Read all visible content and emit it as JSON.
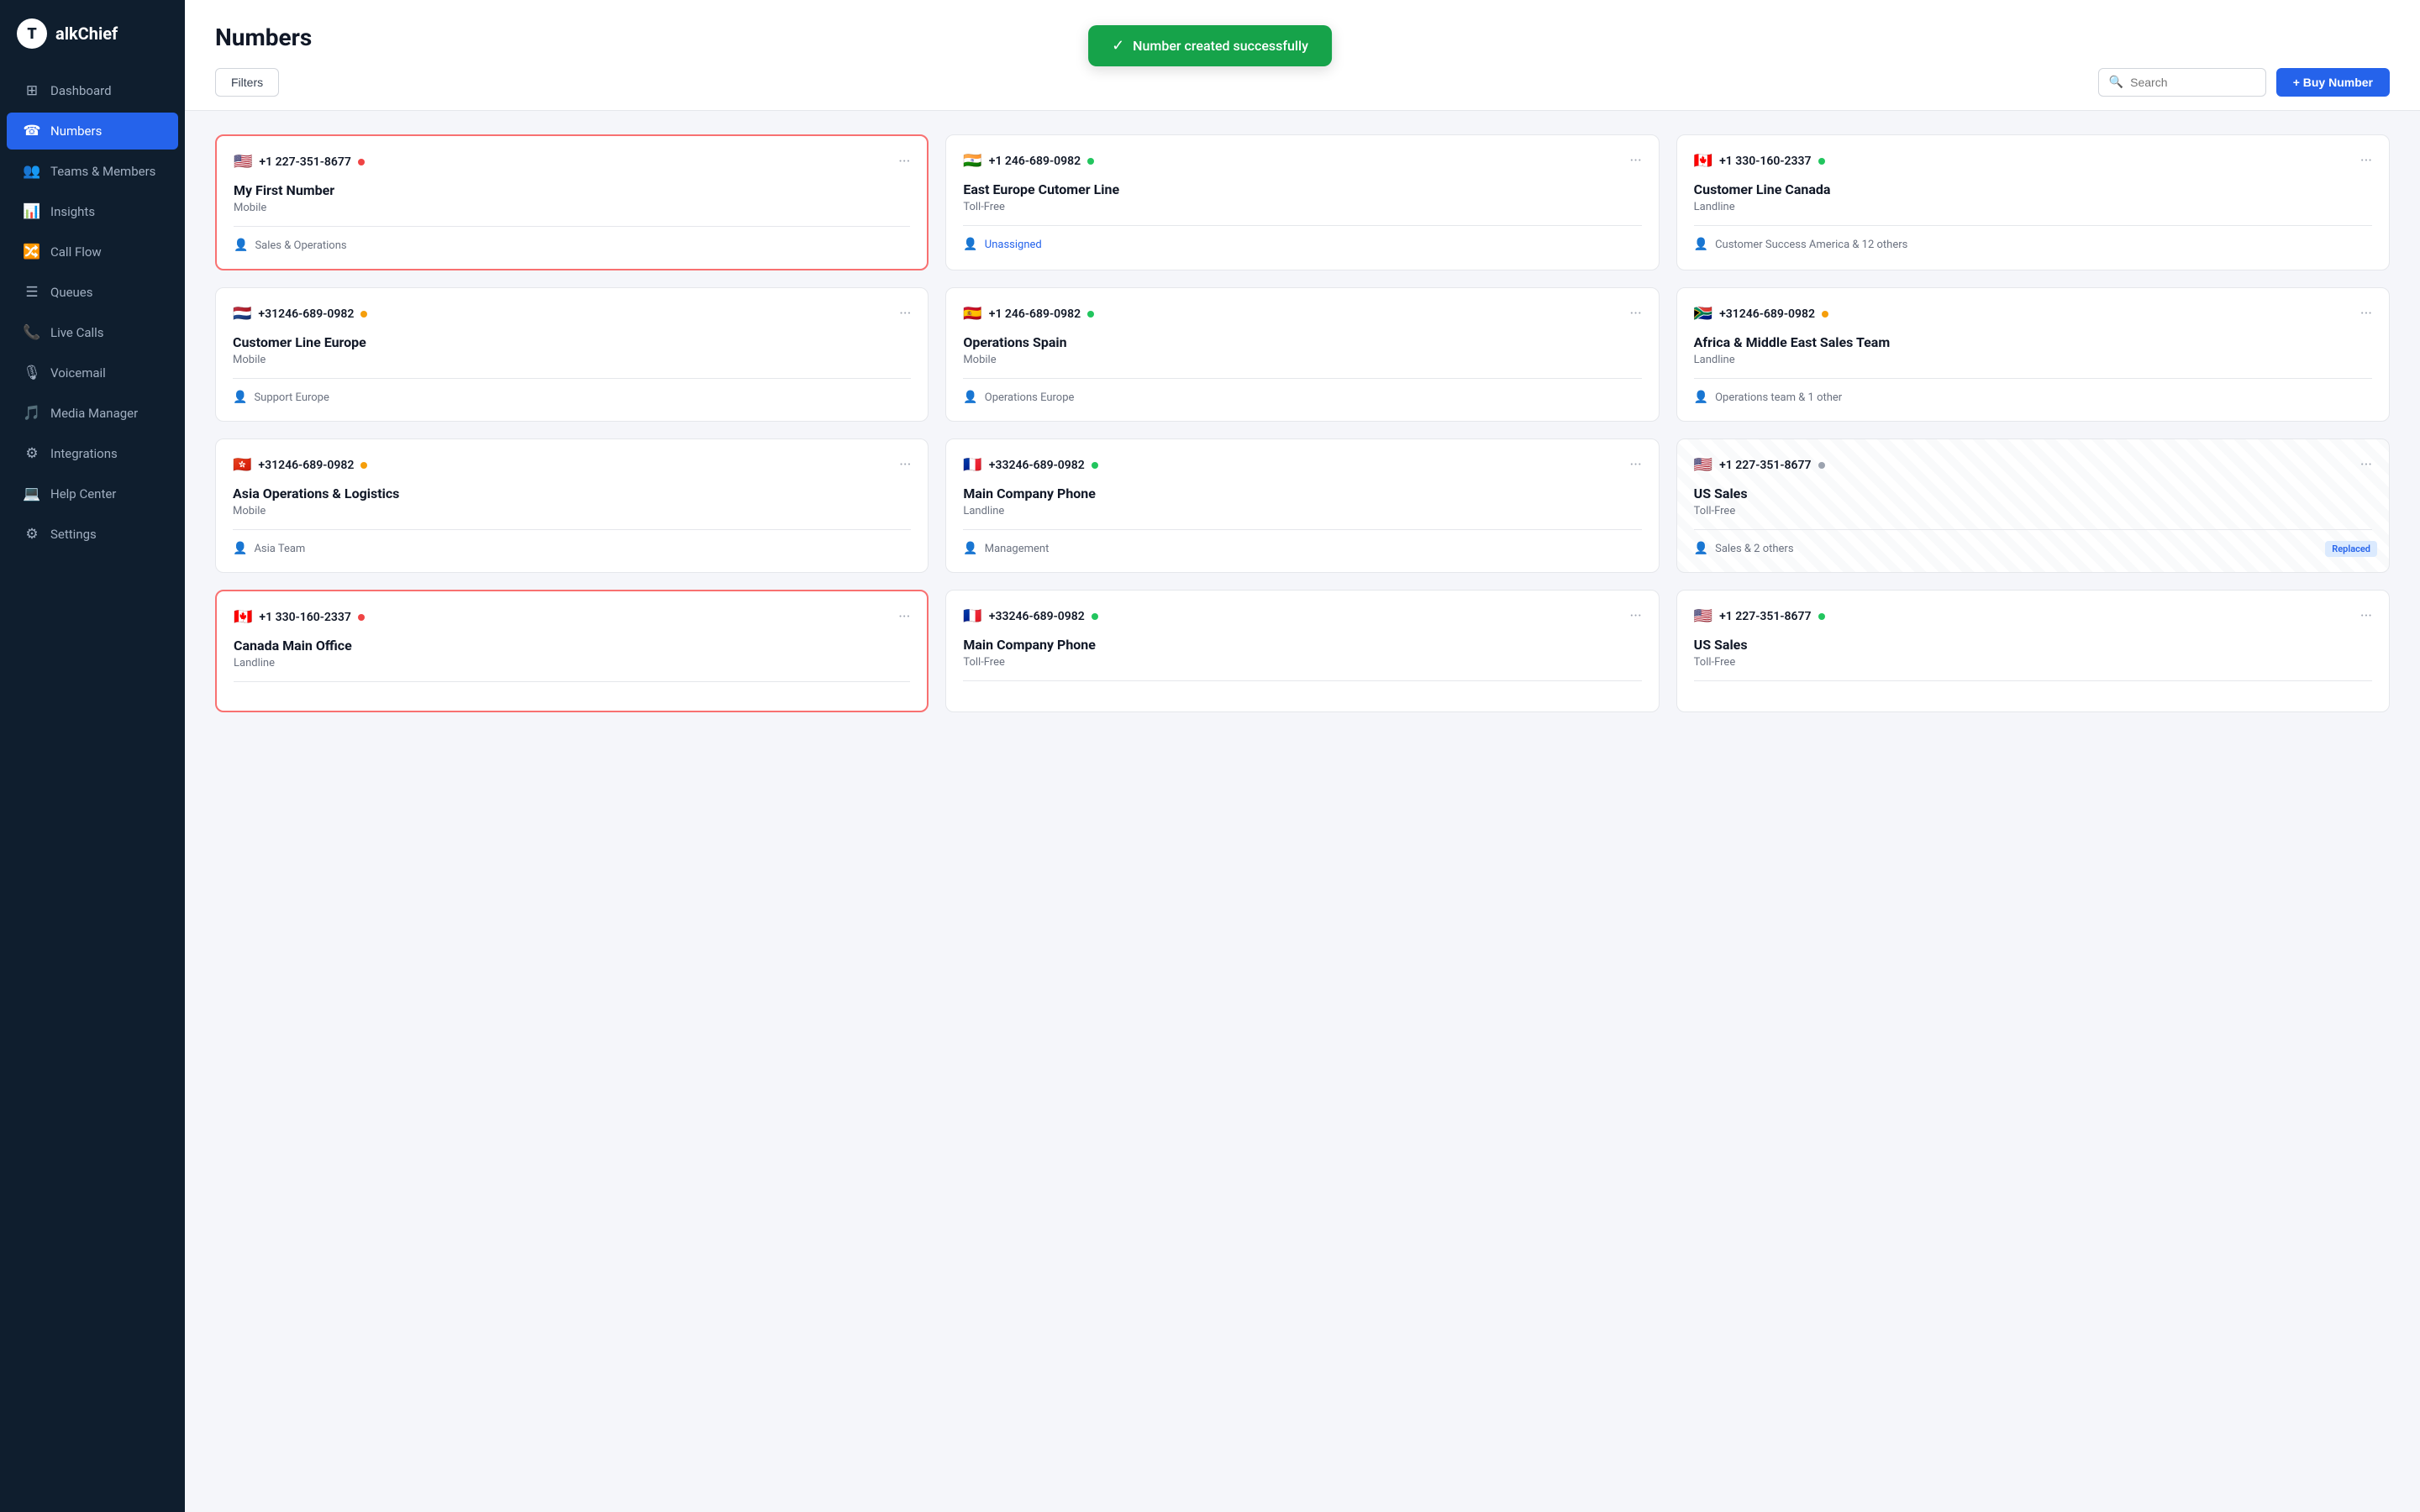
{
  "sidebar": {
    "logo": "T",
    "brand": "alkChief",
    "items": [
      {
        "id": "dashboard",
        "label": "Dashboard",
        "icon": "⊞",
        "active": false
      },
      {
        "id": "numbers",
        "label": "Numbers",
        "icon": "☎",
        "active": true
      },
      {
        "id": "teams",
        "label": "Teams & Members",
        "icon": "👥",
        "active": false
      },
      {
        "id": "insights",
        "label": "Insights",
        "icon": "📊",
        "active": false
      },
      {
        "id": "callflow",
        "label": "Call Flow",
        "icon": "🔀",
        "active": false
      },
      {
        "id": "queues",
        "label": "Queues",
        "icon": "☰",
        "active": false
      },
      {
        "id": "livecalls",
        "label": "Live Calls",
        "icon": "📞",
        "active": false
      },
      {
        "id": "voicemail",
        "label": "Voicemail",
        "icon": "🎙",
        "active": false
      },
      {
        "id": "media",
        "label": "Media Manager",
        "icon": "🎵",
        "active": false
      },
      {
        "id": "integrations",
        "label": "Integrations",
        "icon": "⚙",
        "active": false
      },
      {
        "id": "help",
        "label": "Help Center",
        "icon": "💻",
        "active": false
      },
      {
        "id": "settings",
        "label": "Settings",
        "icon": "⚙",
        "active": false
      }
    ]
  },
  "page": {
    "title": "Numbers",
    "filter_label": "Filters",
    "search_placeholder": "Search",
    "buy_label": "+ Buy Number"
  },
  "toast": {
    "message": "Number created successfully",
    "icon": "✓"
  },
  "numbers": [
    {
      "id": 1,
      "flag": "🇺🇸",
      "number": "+1 227-351-8677",
      "status": "red",
      "name": "My First Number",
      "type": "Mobile",
      "team": "Sales & Operations",
      "unassigned": false,
      "highlighted": true,
      "replaced": false
    },
    {
      "id": 2,
      "flag": "🇮🇳",
      "number": "+1 246-689-0982",
      "status": "green",
      "name": "East Europe Cutomer Line",
      "type": "Toll-Free",
      "team": "Unassigned",
      "unassigned": true,
      "highlighted": false,
      "replaced": false
    },
    {
      "id": 3,
      "flag": "🇨🇦",
      "number": "+1 330-160-2337",
      "status": "green",
      "name": "Customer Line Canada",
      "type": "Landline",
      "team": "Customer Success America & 12 others",
      "unassigned": false,
      "highlighted": false,
      "replaced": false
    },
    {
      "id": 4,
      "flag": "🇳🇱",
      "number": "+31246-689-0982",
      "status": "yellow",
      "name": "Customer Line Europe",
      "type": "Mobile",
      "team": "Support Europe",
      "unassigned": false,
      "highlighted": false,
      "replaced": false
    },
    {
      "id": 5,
      "flag": "🇪🇸",
      "number": "+1 246-689-0982",
      "status": "green",
      "name": "Operations Spain",
      "type": "Mobile",
      "team": "Operations Europe",
      "unassigned": false,
      "highlighted": false,
      "replaced": false
    },
    {
      "id": 6,
      "flag": "🇿🇦",
      "number": "+31246-689-0982",
      "status": "yellow",
      "name": "Africa & Middle East Sales Team",
      "type": "Landline",
      "team": "Operations team & 1 other",
      "unassigned": false,
      "highlighted": false,
      "replaced": false
    },
    {
      "id": 7,
      "flag": "🇭🇰",
      "number": "+31246-689-0982",
      "status": "yellow",
      "name": "Asia Operations & Logistics",
      "type": "Mobile",
      "team": "Asia Team",
      "unassigned": false,
      "highlighted": false,
      "replaced": false
    },
    {
      "id": 8,
      "flag": "🇫🇷",
      "number": "+33246-689-0982",
      "status": "green",
      "name": "Main Company Phone",
      "type": "Landline",
      "team": "Management",
      "unassigned": false,
      "highlighted": false,
      "replaced": false
    },
    {
      "id": 9,
      "flag": "🇺🇸",
      "number": "+1 227-351-8677",
      "status": "gray",
      "name": "US Sales",
      "type": "Toll-Free",
      "team": "Sales & 2 others",
      "unassigned": false,
      "highlighted": false,
      "replaced": true
    },
    {
      "id": 10,
      "flag": "🇨🇦",
      "number": "+1 330-160-2337",
      "status": "red",
      "name": "Canada Main Office",
      "type": "Landline",
      "team": "",
      "unassigned": false,
      "highlighted": true,
      "replaced": false
    },
    {
      "id": 11,
      "flag": "🇫🇷",
      "number": "+33246-689-0982",
      "status": "green",
      "name": "Main Company Phone",
      "type": "Toll-Free",
      "team": "",
      "unassigned": false,
      "highlighted": false,
      "replaced": false
    },
    {
      "id": 12,
      "flag": "🇺🇸",
      "number": "+1 227-351-8677",
      "status": "green",
      "name": "US Sales",
      "type": "Toll-Free",
      "team": "",
      "unassigned": false,
      "highlighted": false,
      "replaced": false
    }
  ]
}
